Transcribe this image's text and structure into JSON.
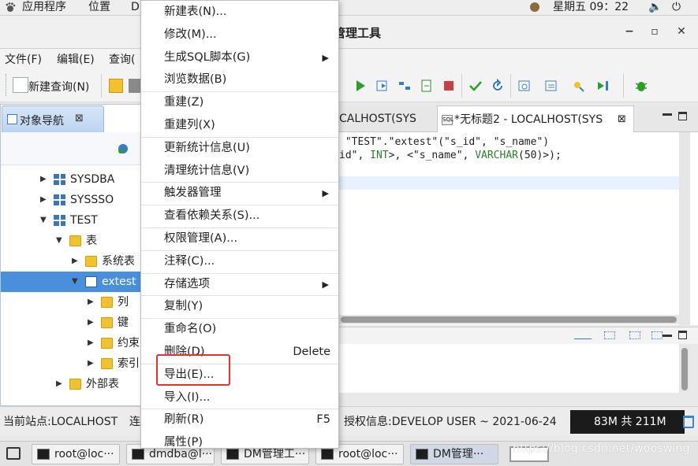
{
  "topbar": {
    "apps": "应用程序",
    "places": "位置",
    "dm": "DM",
    "datetime": "星期五 09：22"
  },
  "window": {
    "title": "管理工具",
    "minimize": "−",
    "maximize": "▫",
    "close": "✕"
  },
  "menubar": {
    "file": "文件(F)",
    "edit": "编辑(E)",
    "query": "查询("
  },
  "toolbar": {
    "new_query": "新建查询(N)"
  },
  "navigator": {
    "tab_label": "对象导航",
    "tab_close": "⊠",
    "tree": [
      {
        "label": "SYSDBA",
        "indent": 1,
        "arrow": "▶",
        "icon": "schema"
      },
      {
        "label": "SYSSSO",
        "indent": 1,
        "arrow": "▶",
        "icon": "schema"
      },
      {
        "label": "TEST",
        "indent": 1,
        "arrow": "▼",
        "icon": "schema"
      },
      {
        "label": "表",
        "indent": 2,
        "arrow": "▼",
        "icon": "folder"
      },
      {
        "label": "系统表",
        "indent": 3,
        "arrow": "▶",
        "icon": "folder"
      },
      {
        "label": "extest",
        "indent": 3,
        "arrow": "▼",
        "icon": "table",
        "selected": true
      },
      {
        "label": "列",
        "indent": 4,
        "arrow": "▶",
        "icon": "folder"
      },
      {
        "label": "键",
        "indent": 4,
        "arrow": "▶",
        "icon": "folder"
      },
      {
        "label": "约束",
        "indent": 4,
        "arrow": "▶",
        "icon": "folder"
      },
      {
        "label": "索引",
        "indent": 4,
        "arrow": "▶",
        "icon": "folder"
      },
      {
        "label": "外部表",
        "indent": 2,
        "arrow": "▶",
        "icon": "folder"
      }
    ]
  },
  "editor": {
    "tab1": "CALHOST(SYS",
    "tab2": "*无标题2 - LOCALHOST(SYS",
    "tab2_close": "⊠",
    "line1": " \"TEST\".\"extest\"(\"s_id\", \"s_name\")",
    "line2_pre": "id\", ",
    "line2_kw1": "INT",
    "line2_mid": ">, <\"s_name\", ",
    "line2_kw2": "VARCHAR",
    "line2_post": "(50)>);"
  },
  "statusbar": {
    "site": "当前站点:LOCALHOST",
    "conn": "连",
    "license": "授权信息:DEVELOP USER ~ 2021-06-24",
    "memory": "83M 共 211M"
  },
  "taskbar": [
    {
      "label": "root@loc···",
      "active": false
    },
    {
      "label": "dmdba@l···",
      "active": false
    },
    {
      "label": "DM管理工···",
      "active": false
    },
    {
      "label": "root@loc···",
      "active": false
    },
    {
      "label": "DM管理···",
      "active": true
    }
  ],
  "watermark": "https://blog.csdn.net/wooswing",
  "context_menu": {
    "items": [
      {
        "label": "新建表(N)...",
        "name": "menu-new-table"
      },
      {
        "label": "修改(M)...",
        "name": "menu-modify"
      },
      {
        "label": "生成SQL脚本(G)",
        "name": "menu-generate-sql",
        "submenu": true
      },
      {
        "label": "浏览数据(B)",
        "name": "menu-browse-data"
      },
      {
        "sep": true
      },
      {
        "label": "重建(Z)",
        "name": "menu-rebuild"
      },
      {
        "label": "重建列(X)",
        "name": "menu-rebuild-columns"
      },
      {
        "sep": true
      },
      {
        "label": "更新统计信息(U)",
        "name": "menu-update-stats"
      },
      {
        "label": "清理统计信息(V)",
        "name": "menu-clear-stats"
      },
      {
        "sep": true
      },
      {
        "label": "触发器管理",
        "name": "menu-trigger-mgmt",
        "submenu": true
      },
      {
        "sep": true
      },
      {
        "label": "查看依赖关系(S)...",
        "name": "menu-view-dependencies"
      },
      {
        "sep": true
      },
      {
        "label": "权限管理(A)...",
        "name": "menu-permissions"
      },
      {
        "sep": true
      },
      {
        "label": "注释(C)...",
        "name": "menu-comment"
      },
      {
        "sep": true
      },
      {
        "label": "存储选项",
        "name": "menu-storage-options",
        "submenu": true
      },
      {
        "sep": true
      },
      {
        "label": "复制(Y)",
        "name": "menu-copy"
      },
      {
        "sep": true
      },
      {
        "label": "重命名(O)",
        "name": "menu-rename"
      },
      {
        "label": "删除(D)",
        "name": "menu-delete",
        "accel": "Delete"
      },
      {
        "sep": true
      },
      {
        "label": "导出(E)...",
        "name": "menu-export"
      },
      {
        "label": "导入(I)...",
        "name": "menu-import"
      },
      {
        "sep": true
      },
      {
        "label": "刷新(R)",
        "name": "menu-refresh",
        "accel": "F5"
      },
      {
        "label": "属性(P)",
        "name": "menu-properties"
      }
    ]
  }
}
